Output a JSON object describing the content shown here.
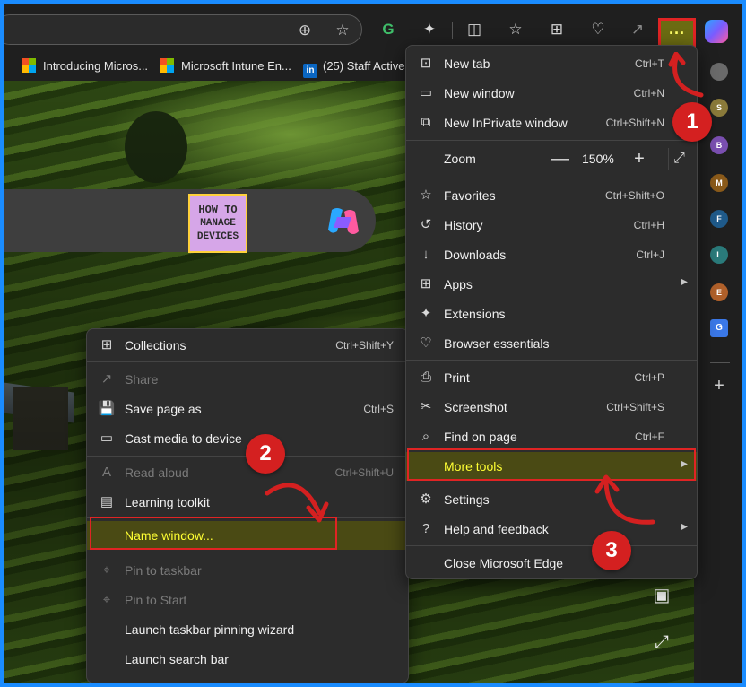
{
  "bookmarks": [
    {
      "label": "Introducing Micros...",
      "icon": "microsoft-logo"
    },
    {
      "label": "Microsoft Intune En...",
      "icon": "microsoft-logo"
    },
    {
      "label": "(25) Staff Active",
      "icon": "linkedin-logo"
    }
  ],
  "toolbar": {
    "more_label": "···",
    "icons": [
      "zoom-icon",
      "favorite-star-icon",
      "grammarly-icon",
      "extensions-icon",
      "split-screen-icon",
      "favorites-icon",
      "collections-icon",
      "browser-essentials-icon",
      "share-icon",
      "copilot-icon"
    ]
  },
  "logo": {
    "line1": "HOW TO",
    "line2": "MANAGE",
    "line3": "DEVICES"
  },
  "rail": {
    "avatars": [
      "S",
      "B",
      "M",
      "F",
      "L",
      "E"
    ],
    "avatar_colors": [
      "#8a7a3a",
      "#7a4fb0",
      "#8a5a1a",
      "#1f5a8a",
      "#2a7a7a",
      "#b0602a"
    ]
  },
  "main_menu": {
    "items": [
      {
        "label": "New tab",
        "shortcut": "Ctrl+T",
        "icon": "new-tab-icon"
      },
      {
        "label": "New window",
        "shortcut": "Ctrl+N",
        "icon": "new-window-icon"
      },
      {
        "label": "New InPrivate window",
        "shortcut": "Ctrl+Shift+N",
        "icon": "inprivate-icon"
      },
      {
        "label": "Zoom",
        "value": "150%",
        "minus": "—",
        "plus": "+",
        "icon": "zoom-row"
      },
      {
        "label": "Favorites",
        "shortcut": "Ctrl+Shift+O",
        "icon": "favorites-icon"
      },
      {
        "label": "History",
        "shortcut": "Ctrl+H",
        "icon": "history-icon"
      },
      {
        "label": "Downloads",
        "shortcut": "Ctrl+J",
        "icon": "downloads-icon"
      },
      {
        "label": "Apps",
        "shortcut": "",
        "icon": "apps-icon"
      },
      {
        "label": "Extensions",
        "shortcut": "",
        "icon": "extensions-icon"
      },
      {
        "label": "Browser essentials",
        "shortcut": "",
        "icon": "browser-essentials-icon"
      },
      {
        "label": "Print",
        "shortcut": "Ctrl+P",
        "icon": "print-icon"
      },
      {
        "label": "Screenshot",
        "shortcut": "Ctrl+Shift+S",
        "icon": "screenshot-icon"
      },
      {
        "label": "Find on page",
        "shortcut": "Ctrl+F",
        "icon": "find-icon"
      },
      {
        "label": "More tools",
        "shortcut": "",
        "icon": "more-tools-icon"
      },
      {
        "label": "Settings",
        "shortcut": "",
        "icon": "settings-icon"
      },
      {
        "label": "Help and feedback",
        "shortcut": "",
        "icon": "help-icon"
      },
      {
        "label": "Close Microsoft Edge",
        "shortcut": "",
        "icon": ""
      }
    ]
  },
  "sub_menu": {
    "items": [
      {
        "label": "Collections",
        "shortcut": "Ctrl+Shift+Y",
        "icon": "collections-icon"
      },
      {
        "label": "Share",
        "shortcut": "",
        "icon": "share-icon",
        "disabled": true
      },
      {
        "label": "Save page as",
        "shortcut": "Ctrl+S",
        "icon": "save-icon"
      },
      {
        "label": "Cast media to device",
        "shortcut": "",
        "icon": "cast-icon"
      },
      {
        "label": "Read aloud",
        "shortcut": "Ctrl+Shift+U",
        "icon": "read-aloud-icon",
        "disabled": true
      },
      {
        "label": "Learning toolkit",
        "shortcut": "",
        "icon": "learning-toolkit-icon"
      },
      {
        "label": "Name window...",
        "shortcut": "",
        "icon": ""
      },
      {
        "label": "Pin to taskbar",
        "shortcut": "",
        "icon": "pin-icon",
        "disabled": true
      },
      {
        "label": "Pin to Start",
        "shortcut": "",
        "icon": "pin-icon",
        "disabled": true
      },
      {
        "label": "Launch taskbar pinning wizard",
        "shortcut": "",
        "icon": ""
      },
      {
        "label": "Launch search bar",
        "shortcut": "",
        "icon": ""
      }
    ]
  },
  "annotations": {
    "step1": "1",
    "step2": "2",
    "step3": "3",
    "color": "#d42020"
  }
}
